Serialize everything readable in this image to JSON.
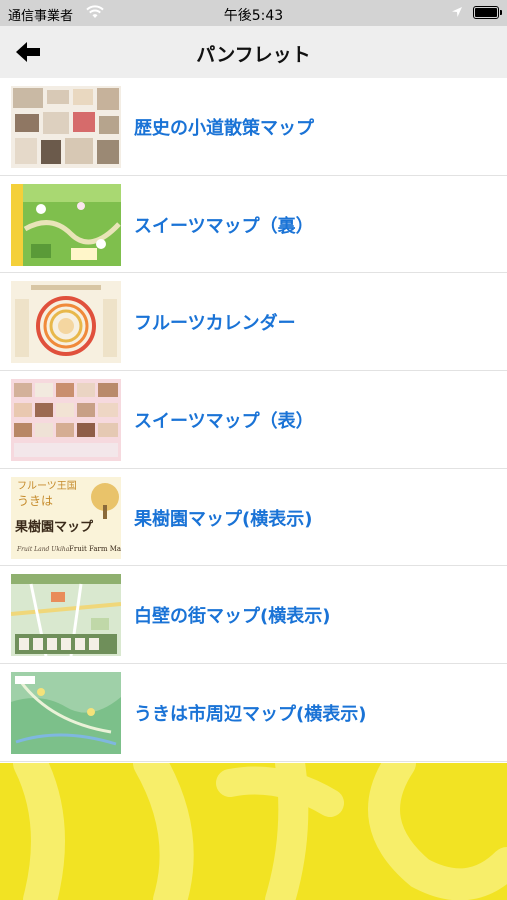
{
  "status_bar": {
    "carrier": "通信事業者",
    "time": "午後5:43"
  },
  "nav": {
    "title": "パンフレット",
    "back_icon": "arrow-left-icon"
  },
  "items": [
    {
      "label": "歴史の小道散策マップ"
    },
    {
      "label": "スイーツマップ（裏）"
    },
    {
      "label": "フルーツカレンダー"
    },
    {
      "label": "スイーツマップ（表）"
    },
    {
      "label": "果樹園マップ(横表示)",
      "thumb_text": [
        "フルーツ王国",
        "うきは",
        "果樹園マップ",
        "Fruit Land Ukiha",
        "Fruit Farm Map"
      ]
    },
    {
      "label": "白壁の街マップ(横表示)"
    },
    {
      "label": "うきは市周辺マップ(横表示)"
    }
  ],
  "colors": {
    "link": "#1a73d6",
    "nav_bg": "#eeeeee",
    "status_bg": "#d3d3d3",
    "banner": "#f2e323"
  }
}
